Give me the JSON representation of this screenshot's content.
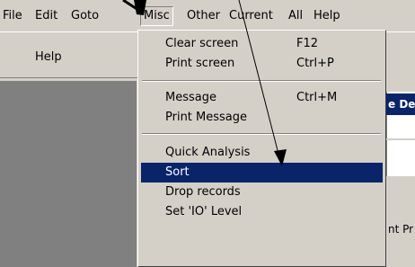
{
  "menubar": [
    "File",
    "Edit",
    "Goto",
    "Misc",
    "Other",
    "Current",
    "All",
    "Help"
  ],
  "toolbar": {
    "help_label": "Help"
  },
  "menu": {
    "items": [
      {
        "label": "Clear screen",
        "shortcut": "F12"
      },
      {
        "label": "Print screen",
        "shortcut": "Ctrl+P"
      },
      {
        "label": "Message",
        "shortcut": "Ctrl+M"
      },
      {
        "label": "Print Message",
        "shortcut": ""
      },
      {
        "label": "Quick Analysis",
        "shortcut": ""
      },
      {
        "label": "Sort",
        "shortcut": ""
      },
      {
        "label": "Drop records",
        "shortcut": ""
      },
      {
        "label": "Set 'IO' Level",
        "shortcut": ""
      }
    ],
    "highlighted": "Sort"
  },
  "background": {
    "header_fragment": "e De",
    "text_fragment": "nt Pr"
  },
  "colors": {
    "highlight": "#0a246a",
    "face": "#d4d0c8",
    "panel": "#808080"
  }
}
